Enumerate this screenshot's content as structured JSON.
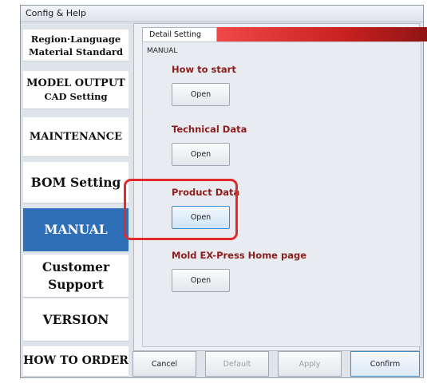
{
  "window": {
    "title": "Config & Help"
  },
  "sidebar": {
    "items": [
      {
        "lines": [
          "Region·Language",
          "Material Standard"
        ]
      },
      {
        "lines": [
          "MODEL OUTPUT",
          "CAD Setting"
        ]
      },
      {
        "lines": [
          "MAINTENANCE"
        ]
      },
      {
        "lines": [
          "BOM Setting"
        ]
      },
      {
        "lines": [
          "MANUAL"
        ],
        "selected": true
      },
      {
        "lines": [
          "Customer",
          "Support"
        ]
      },
      {
        "lines": [
          "VERSION"
        ]
      },
      {
        "lines": [
          "HOW TO ORDER"
        ]
      }
    ]
  },
  "tab": {
    "label": "Detail Setting"
  },
  "panel": {
    "label": "MANUAL",
    "groups": [
      {
        "title": "How to start",
        "button": "Open"
      },
      {
        "title": "Technical Data",
        "button": "Open"
      },
      {
        "title": "Product Data",
        "button": "Open"
      },
      {
        "title": "Mold EX-Press Home page",
        "button": "Open"
      }
    ]
  },
  "footer": {
    "cancel": "Cancel",
    "default": "Default",
    "apply": "Apply",
    "confirm": "Confirm"
  },
  "colors": {
    "selected_nav": "#2f6fb7",
    "group_title": "#8c1d1d",
    "highlight_box": "#e12a2a",
    "tab_accent": "#c92020"
  }
}
